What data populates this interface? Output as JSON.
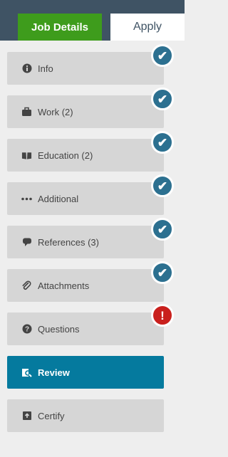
{
  "tabs": {
    "job_details": "Job Details",
    "apply": "Apply"
  },
  "steps": [
    {
      "label": "Info",
      "icon": "info-icon",
      "status": "complete"
    },
    {
      "label": "Work (2)",
      "icon": "briefcase-icon",
      "status": "complete"
    },
    {
      "label": "Education (2)",
      "icon": "book-icon",
      "status": "complete"
    },
    {
      "label": "Additional",
      "icon": "ellipsis-icon",
      "status": "complete"
    },
    {
      "label": "References (3)",
      "icon": "speech-bubble-icon",
      "status": "complete"
    },
    {
      "label": "Attachments",
      "icon": "paperclip-icon",
      "status": "complete"
    },
    {
      "label": "Questions",
      "icon": "question-icon",
      "status": "warning"
    },
    {
      "label": "Review",
      "icon": "review-icon",
      "status": "active"
    },
    {
      "label": "Certify",
      "icon": "certify-icon",
      "status": "none"
    }
  ],
  "colors": {
    "header": "#3f5364",
    "job_tab": "#3e9c1c",
    "active_step": "#057a9e",
    "complete_badge": "#2c7090",
    "warning_badge": "#c9201d"
  }
}
